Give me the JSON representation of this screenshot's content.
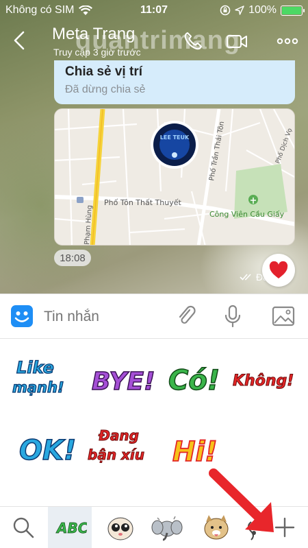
{
  "status_bar": {
    "carrier": "Không có SIM",
    "time": "11:07",
    "battery": "100%",
    "battery_level": 1.0
  },
  "header": {
    "name": "Meta Trang",
    "status": "Truy cập 3 giờ trước",
    "watermark": "quantrimang"
  },
  "messages": {
    "share_title": "Chia sẻ vị trí",
    "share_subtitle": "Đã dừng chia sẻ",
    "map": {
      "street_1": "Phố Tôn Thất Thuyết",
      "street_2": "Phố Trần Thái Tôn",
      "street_3": "Phố Dịch Vọ",
      "street_4": "Phạm Hùng",
      "park": "Công Viên Cầu Giấy",
      "marker_label": "LEE TEUK"
    },
    "time": "18:08",
    "sent_status": "Đã"
  },
  "composer": {
    "placeholder": "Tin nhắn"
  },
  "stickers": [
    {
      "text_1": "Like",
      "text_2": "mạnh!",
      "colors": [
        "#29a8e0",
        "#ffffff"
      ]
    },
    {
      "text_1": "BYE!",
      "colors": [
        "#a54fd6",
        "#ffffff"
      ]
    },
    {
      "text_1": "Có!",
      "colors": [
        "#3ab54a",
        "#ffffff"
      ]
    },
    {
      "text_1": "Không!",
      "colors": [
        "#e32526",
        "#ffffff"
      ]
    },
    {
      "text_1": "OK!",
      "colors": [
        "#29a8e0",
        "#ffffff"
      ]
    },
    {
      "text_1": "Đang",
      "text_2": "bận xíu",
      "colors": [
        "#e32526",
        "#ffffff"
      ]
    },
    {
      "text_1": "Hi!",
      "colors": [
        "#f7c21a",
        "#e32526"
      ]
    }
  ],
  "sticker_tabs": [
    {
      "icon": "search-icon"
    },
    {
      "icon": "abc-sticker-icon",
      "label": "ABC",
      "active": true
    },
    {
      "icon": "cute-face-sticker-icon"
    },
    {
      "icon": "elephant-sticker-icon"
    },
    {
      "icon": "dog-sticker-icon"
    },
    {
      "icon": "partial-sticker-icon"
    },
    {
      "icon": "add-icon"
    }
  ],
  "colors": {
    "accent_blue": "#1e8ef5",
    "share_bubble": "#d6ecfb",
    "heart": "#e3212d",
    "arrow": "#e8262b"
  }
}
